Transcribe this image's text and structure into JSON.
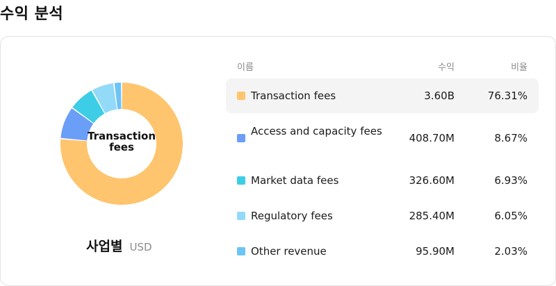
{
  "page": {
    "title": "수익 분석"
  },
  "table": {
    "headers": {
      "name": "이름",
      "revenue": "수익",
      "ratio": "비율"
    },
    "rows": [
      {
        "name": "Transaction fees",
        "revenue": "3.60B",
        "ratio": "76.31%",
        "color": "#FFC46E"
      },
      {
        "name": "Access and capacity fees",
        "revenue": "408.70M",
        "ratio": "8.67%",
        "color": "#6A9EF7"
      },
      {
        "name": "Market data fees",
        "revenue": "326.60M",
        "ratio": "6.93%",
        "color": "#3DCDE6"
      },
      {
        "name": "Regulatory fees",
        "revenue": "285.40M",
        "ratio": "6.05%",
        "color": "#93DAF8"
      },
      {
        "name": "Other revenue",
        "revenue": "95.90M",
        "ratio": "2.03%",
        "color": "#6CC4F5"
      }
    ]
  },
  "chart": {
    "center_label": "Transaction fees",
    "caption_title": "사업별",
    "caption_unit": "USD"
  },
  "chart_data": {
    "type": "pie",
    "categories": [
      "Transaction fees",
      "Access and capacity fees",
      "Market data fees",
      "Regulatory fees",
      "Other revenue"
    ],
    "values": [
      76.31,
      8.67,
      6.93,
      6.05,
      2.03
    ],
    "colors": [
      "#FFC46E",
      "#6A9EF7",
      "#3DCDE6",
      "#93DAF8",
      "#6CC4F5"
    ],
    "highlighted": "Transaction fees"
  }
}
